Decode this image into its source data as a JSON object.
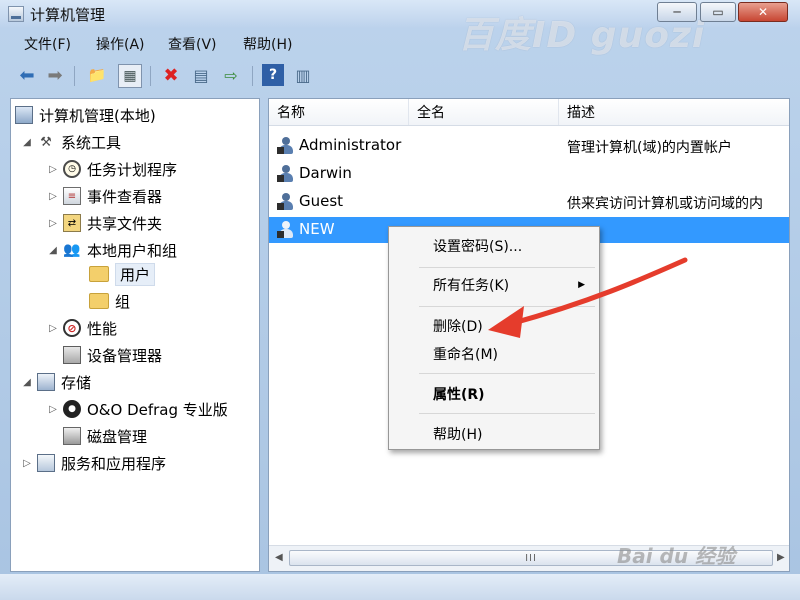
{
  "window": {
    "title": "计算机管理",
    "watermark": "百度ID guozi",
    "controls": {
      "minimize": "─",
      "maximize": "▭",
      "close": "✕"
    }
  },
  "menubar": {
    "items": [
      {
        "label": "文件(F)"
      },
      {
        "label": "操作(A)"
      },
      {
        "label": "查看(V)"
      },
      {
        "label": "帮助(H)"
      }
    ]
  },
  "toolbar": {
    "buttons": [
      {
        "icon": "back-arrow-icon",
        "glyph": "⬅"
      },
      {
        "icon": "forward-arrow-icon",
        "glyph": "➡"
      },
      {
        "icon": "up-folder-icon",
        "glyph": "📁"
      },
      {
        "icon": "show-hide-tree-icon",
        "glyph": "▦"
      },
      {
        "icon": "delete-icon",
        "glyph": "✖"
      },
      {
        "icon": "properties-icon",
        "glyph": "▤"
      },
      {
        "icon": "export-list-icon",
        "glyph": "⇨"
      },
      {
        "icon": "help-icon",
        "glyph": "?"
      },
      {
        "icon": "view-icon",
        "glyph": "▥"
      }
    ]
  },
  "tree": {
    "items": [
      {
        "label": "计算机管理(本地)",
        "icon": "computer-management-icon",
        "expander": ""
      },
      {
        "label": "系统工具",
        "icon": "system-tools-icon",
        "expander": "◢"
      },
      {
        "label": "任务计划程序",
        "icon": "task-scheduler-icon",
        "expander": "▷"
      },
      {
        "label": "事件查看器",
        "icon": "event-viewer-icon",
        "expander": "▷"
      },
      {
        "label": "共享文件夹",
        "icon": "shared-folders-icon",
        "expander": "▷"
      },
      {
        "label": "本地用户和组",
        "icon": "local-users-groups-icon",
        "expander": "◢"
      },
      {
        "label": "用户",
        "icon": "folder-icon",
        "expander": ""
      },
      {
        "label": "组",
        "icon": "folder-icon",
        "expander": ""
      },
      {
        "label": "性能",
        "icon": "performance-icon",
        "expander": "▷"
      },
      {
        "label": "设备管理器",
        "icon": "device-manager-icon",
        "expander": ""
      },
      {
        "label": "存储",
        "icon": "storage-icon",
        "expander": "◢"
      },
      {
        "label": "O&O Defrag 专业版",
        "icon": "defrag-icon",
        "expander": "▷"
      },
      {
        "label": "磁盘管理",
        "icon": "disk-management-icon",
        "expander": ""
      },
      {
        "label": "服务和应用程序",
        "icon": "services-apps-icon",
        "expander": "▷"
      }
    ]
  },
  "list": {
    "columns": [
      "名称",
      "全名",
      "描述"
    ],
    "rows": [
      {
        "name": "Administrator",
        "fullname": "",
        "description": "管理计算机(域)的内置帐户"
      },
      {
        "name": "Darwin",
        "fullname": "",
        "description": ""
      },
      {
        "name": "Guest",
        "fullname": "",
        "description": "供来宾访问计算机或访问域的内"
      },
      {
        "name": "NEW",
        "fullname": "",
        "description": ""
      }
    ],
    "scrollbar_grip": "III"
  },
  "context_menu": {
    "items": [
      {
        "label": "设置密码(S)..."
      },
      {
        "label": "所有任务(K)",
        "submenu_arrow": "▶"
      },
      {
        "label": "删除(D)"
      },
      {
        "label": "重命名(M)"
      },
      {
        "label": "属性(R)"
      },
      {
        "label": "帮助(H)"
      }
    ]
  },
  "colors": {
    "selection": "#3399ff",
    "annotation_arrow": "#e53c2c"
  },
  "corner_watermark": "Bai du 经验"
}
